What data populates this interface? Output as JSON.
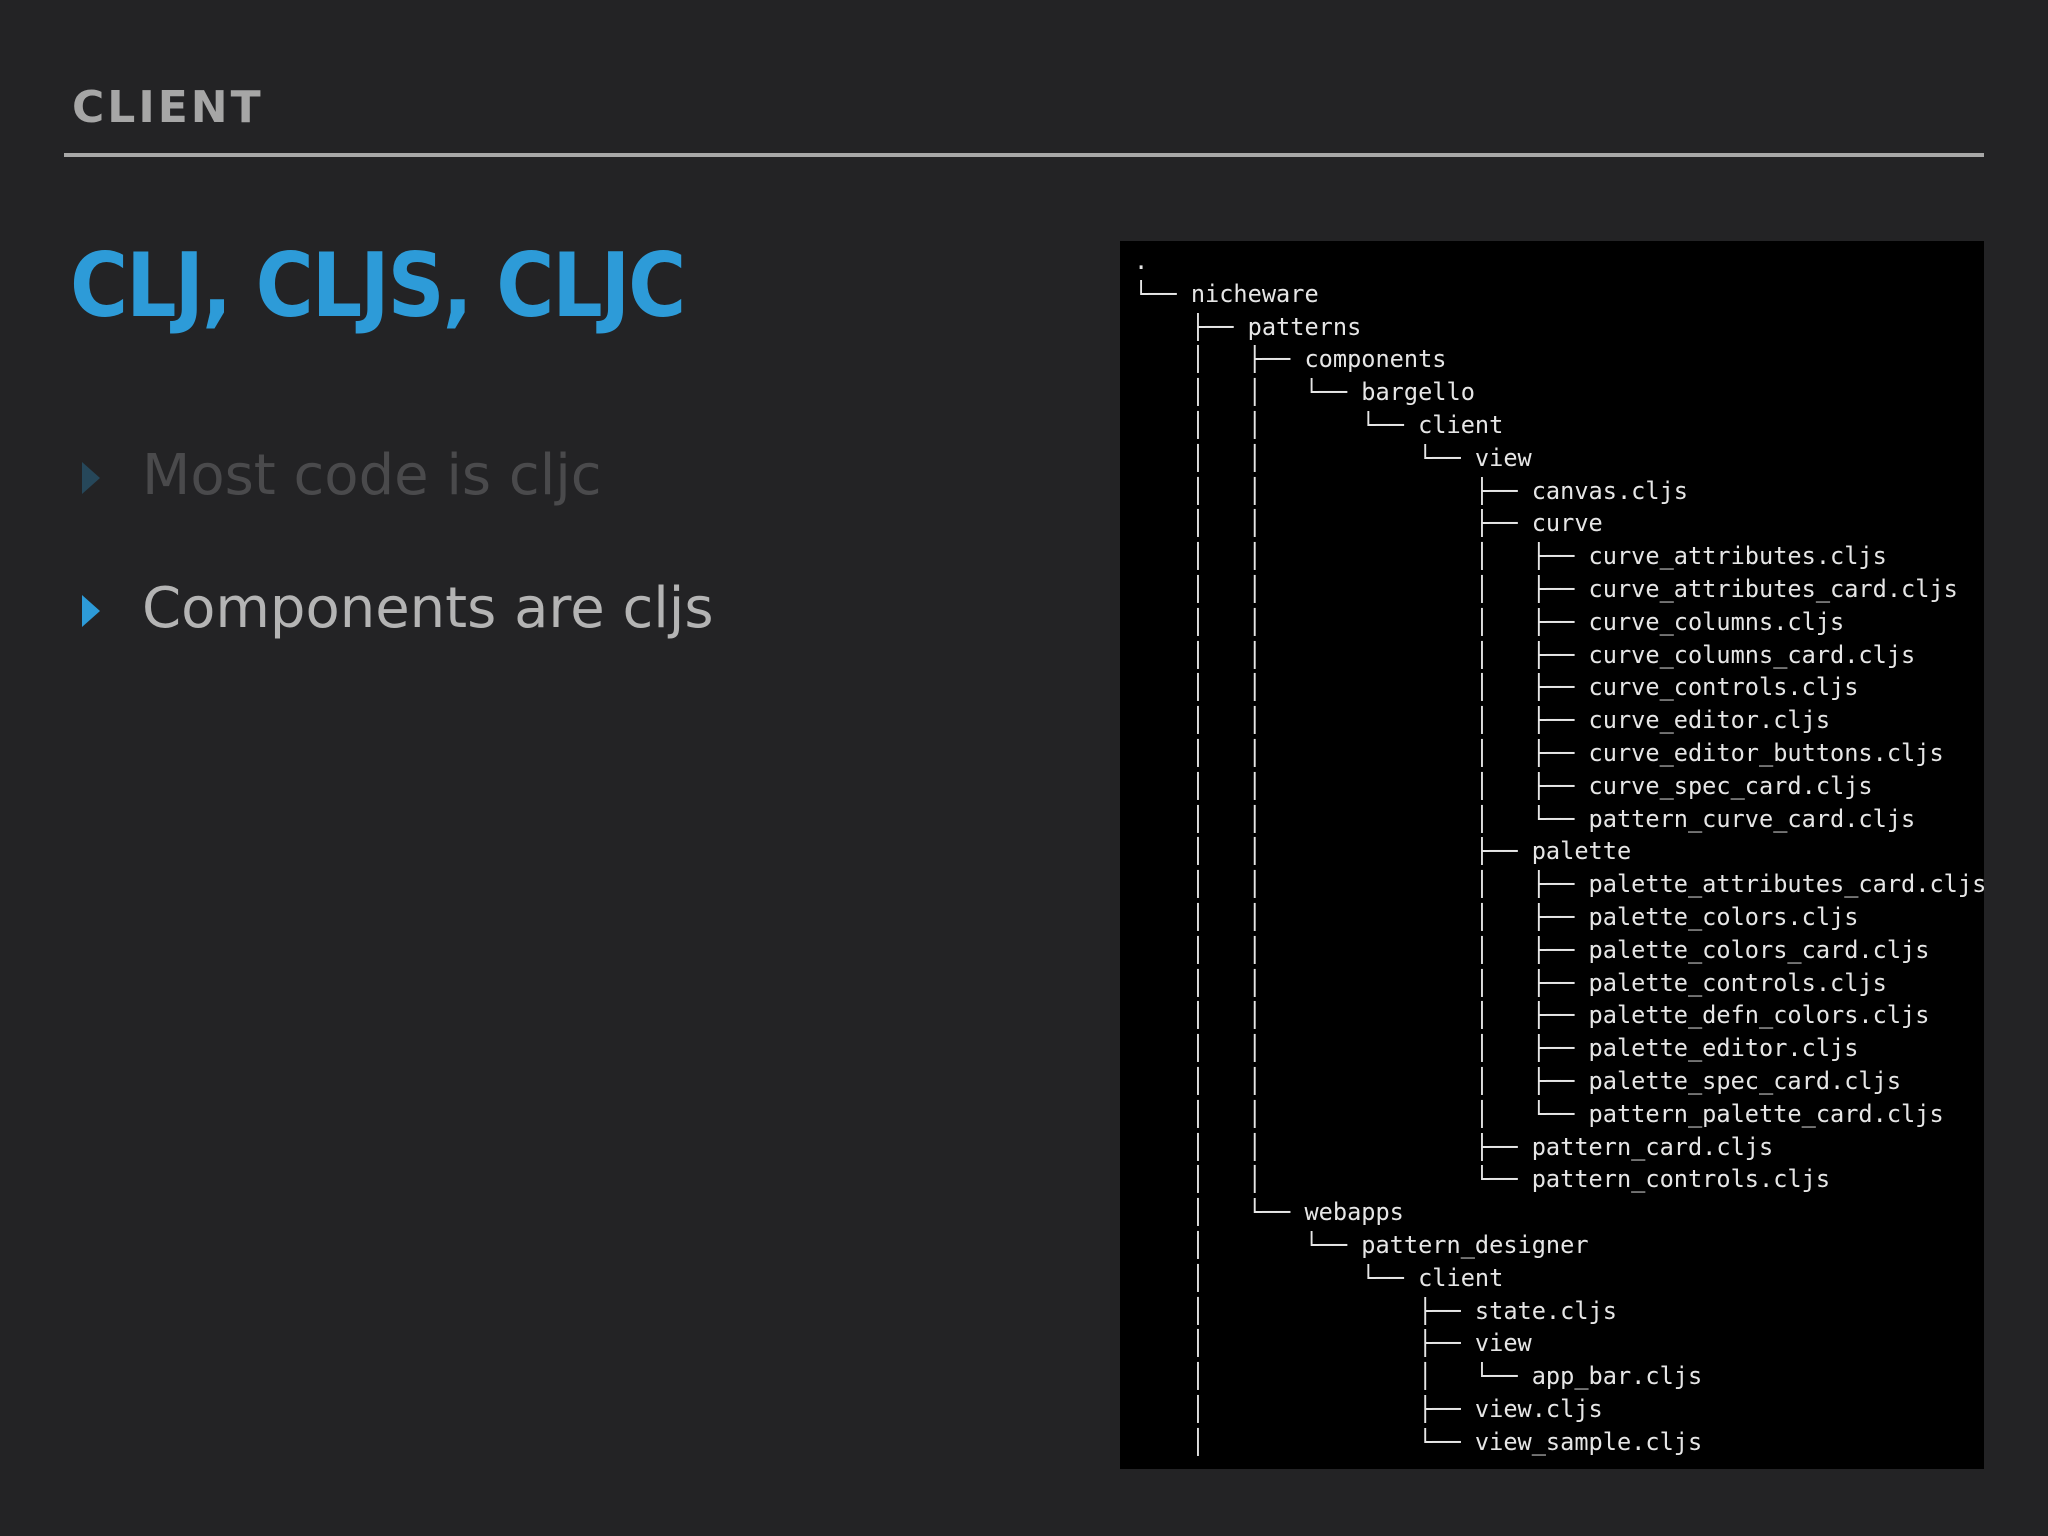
{
  "header": {
    "section_label": "CLIENT",
    "title": "CLJ, CLJS, CLJC"
  },
  "bullets": [
    {
      "text": "Most code is cljc",
      "state": "dimmed"
    },
    {
      "text": "Components are cljs",
      "state": "active"
    }
  ],
  "colors": {
    "background": "#232325",
    "accent": "#2d9bd8",
    "terminal_background": "#000000"
  },
  "terminal": {
    "lines": [
      ".",
      "└── nicheware",
      "    ├── patterns",
      "    │   ├── components",
      "    │   │   └── bargello",
      "    │   │       └── client",
      "    │   │           └── view",
      "    │   │               ├── canvas.cljs",
      "    │   │               ├── curve",
      "    │   │               │   ├── curve_attributes.cljs",
      "    │   │               │   ├── curve_attributes_card.cljs",
      "    │   │               │   ├── curve_columns.cljs",
      "    │   │               │   ├── curve_columns_card.cljs",
      "    │   │               │   ├── curve_controls.cljs",
      "    │   │               │   ├── curve_editor.cljs",
      "    │   │               │   ├── curve_editor_buttons.cljs",
      "    │   │               │   ├── curve_spec_card.cljs",
      "    │   │               │   └── pattern_curve_card.cljs",
      "    │   │               ├── palette",
      "    │   │               │   ├── palette_attributes_card.cljs",
      "    │   │               │   ├── palette_colors.cljs",
      "    │   │               │   ├── palette_colors_card.cljs",
      "    │   │               │   ├── palette_controls.cljs",
      "    │   │               │   ├── palette_defn_colors.cljs",
      "    │   │               │   ├── palette_editor.cljs",
      "    │   │               │   ├── palette_spec_card.cljs",
      "    │   │               │   └── pattern_palette_card.cljs",
      "    │   │               ├── pattern_card.cljs",
      "    │   │               └── pattern_controls.cljs",
      "    │   └── webapps",
      "    │       └── pattern_designer",
      "    │           └── client",
      "    │               ├── state.cljs",
      "    │               ├── view",
      "    │               │   └── app_bar.cljs",
      "    │               ├── view.cljs",
      "    │               └── view_sample.cljs"
    ]
  }
}
